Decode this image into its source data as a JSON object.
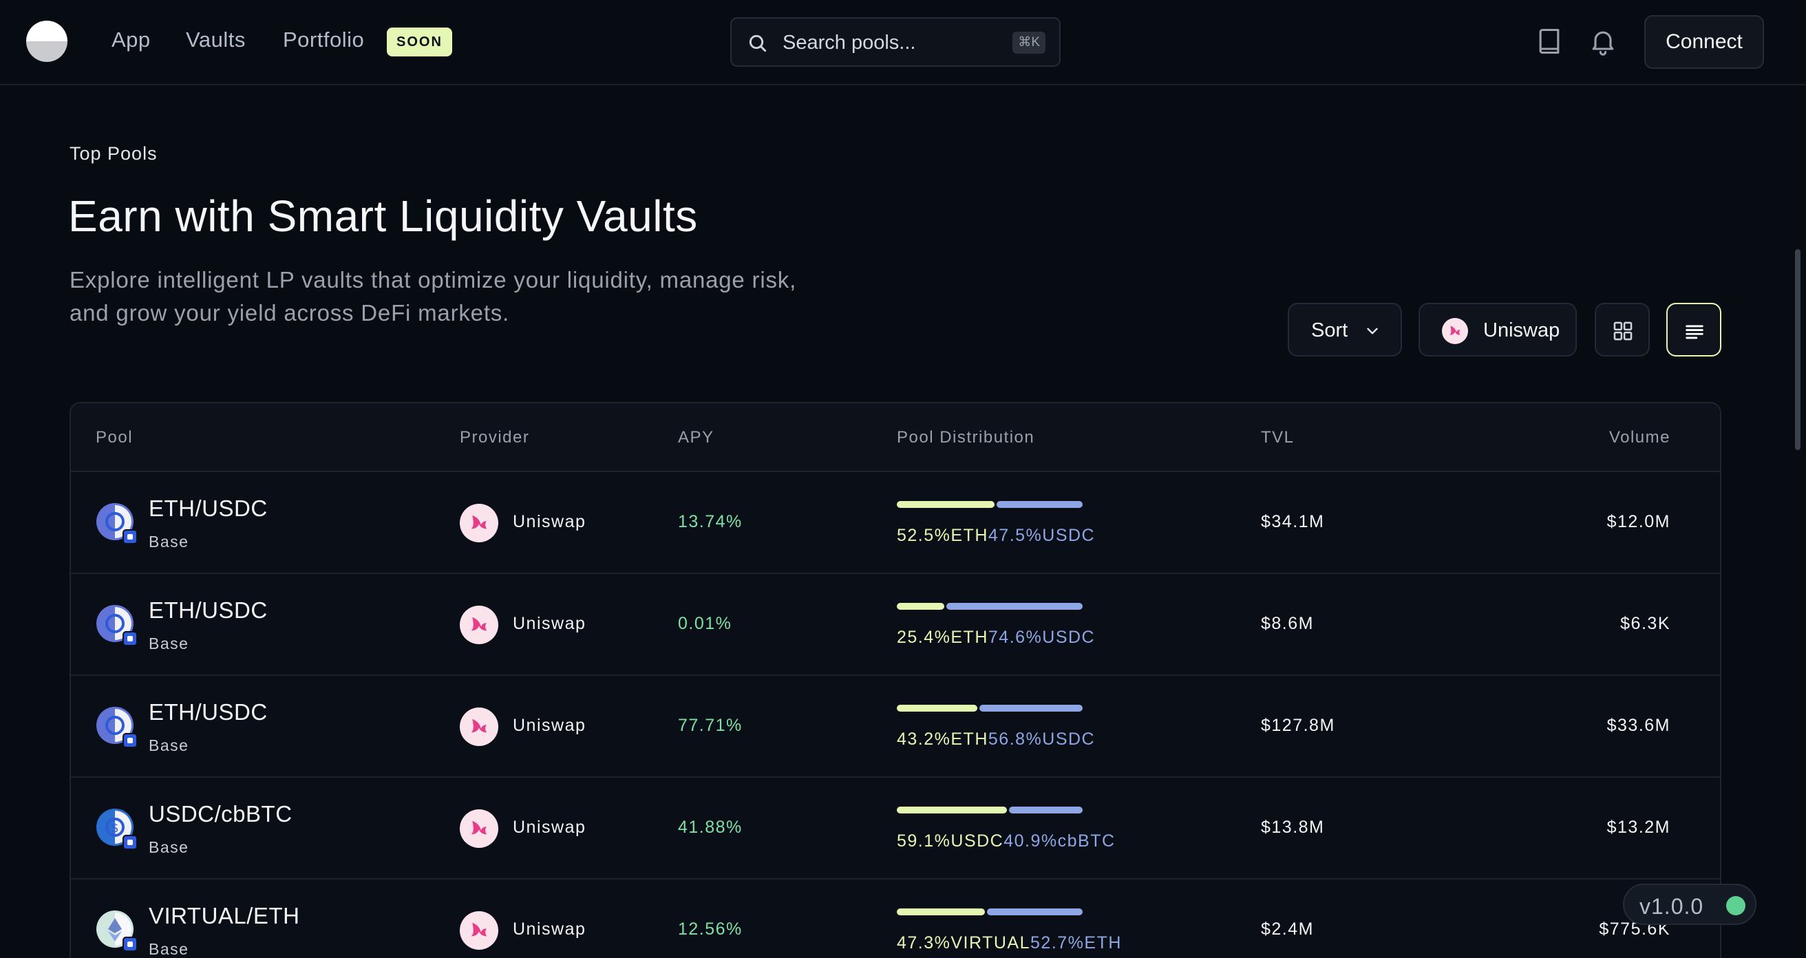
{
  "nav": {
    "links": [
      {
        "label": "App"
      },
      {
        "label": "Vaults"
      },
      {
        "label": "Portfolio"
      }
    ],
    "soon_badge": "SOON",
    "search": {
      "placeholder": "Search pools...",
      "shortcut": "⌘K"
    },
    "connect_label": "Connect"
  },
  "hero": {
    "eyebrow": "Top Pools",
    "title": "Earn with Smart Liquidity Vaults",
    "description_line1": "Explore intelligent LP vaults that optimize your liquidity, manage risk,",
    "description_line2": "and grow your yield across DeFi markets."
  },
  "controls": {
    "sort_label": "Sort",
    "provider_label": "Uniswap"
  },
  "table": {
    "headers": {
      "pool": "Pool",
      "provider": "Provider",
      "apy": "APY",
      "distribution": "Pool Distribution",
      "tvl": "TVL",
      "volume": "Volume"
    },
    "rows": [
      {
        "pool": "ETH/USDC",
        "chain": "Base",
        "provider": "Uniswap",
        "apy": "13.74%",
        "dist_a_pct": 52.5,
        "dist_a": "52.5%ETH",
        "dist_b": "47.5%USDC",
        "tvl": "$34.1M",
        "volume": "$12.0M"
      },
      {
        "pool": "ETH/USDC",
        "chain": "Base",
        "provider": "Uniswap",
        "apy": "0.01%",
        "dist_a_pct": 25.4,
        "dist_a": "25.4%ETH",
        "dist_b": "74.6%USDC",
        "tvl": "$8.6M",
        "volume": "$6.3K"
      },
      {
        "pool": "ETH/USDC",
        "chain": "Base",
        "provider": "Uniswap",
        "apy": "77.71%",
        "dist_a_pct": 43.2,
        "dist_a": "43.2%ETH",
        "dist_b": "56.8%USDC",
        "tvl": "$127.8M",
        "volume": "$33.6M"
      },
      {
        "pool": "USDC/cbBTC",
        "chain": "Base",
        "provider": "Uniswap",
        "apy": "41.88%",
        "dist_a_pct": 59.1,
        "dist_a": "59.1%USDC",
        "dist_b": "40.9%cbBTC",
        "tvl": "$13.8M",
        "volume": "$13.2M"
      },
      {
        "pool": "VIRTUAL/ETH",
        "chain": "Base",
        "provider": "Uniswap",
        "apy": "12.56%",
        "dist_a_pct": 47.3,
        "dist_a": "47.3%VIRTUAL",
        "dist_b": "52.7%ETH",
        "tvl": "$2.4M",
        "volume": "$775.6K"
      }
    ]
  },
  "version": {
    "label": "v1.0.0",
    "status_color": "#5ed192"
  },
  "colors": {
    "accent": "#e3f7b2",
    "secondary": "#8ea6e3",
    "apy": "#7ee0a7",
    "background": "#070b12"
  }
}
